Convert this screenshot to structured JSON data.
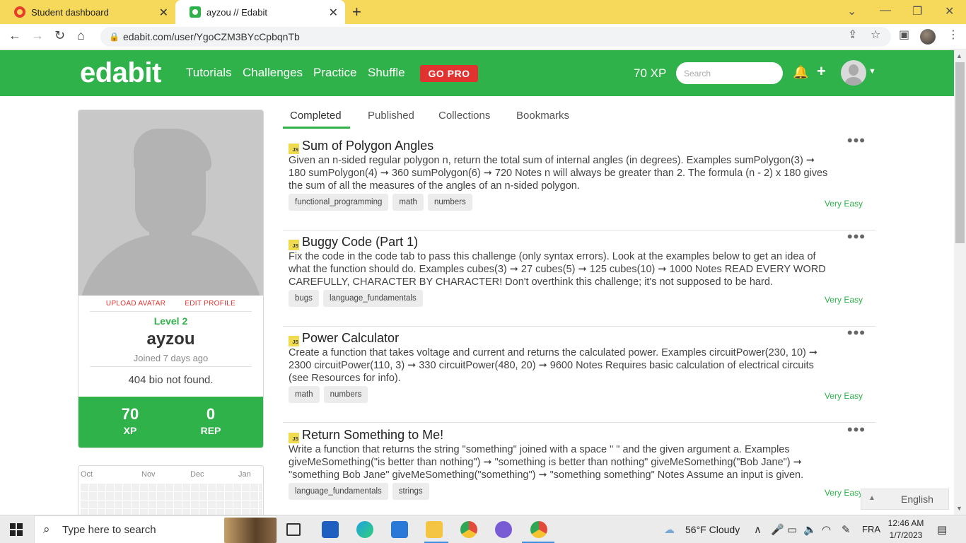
{
  "browser": {
    "tabs": [
      {
        "title": "Student dashboard"
      },
      {
        "title": "ayzou // Edabit"
      }
    ],
    "url": "edabit.com/user/YgoCZM3BYcCpbqnTb"
  },
  "header": {
    "logo": "edabit",
    "nav": [
      "Tutorials",
      "Challenges",
      "Practice",
      "Shuffle"
    ],
    "gopro": "GO PRO",
    "xp": "70 XP",
    "search_placeholder": "Search"
  },
  "profile": {
    "upload_avatar": "UPLOAD AVATAR",
    "edit_profile": "EDIT PROFILE",
    "level": "Level 2",
    "username": "ayzou",
    "joined": "Joined 7 days ago",
    "bio": "404 bio not found.",
    "xp_value": "70",
    "xp_label": "XP",
    "rep_value": "0",
    "rep_label": "REP",
    "months": [
      "Oct",
      "Nov",
      "Dec",
      "Jan"
    ]
  },
  "profile_tabs": [
    "Completed",
    "Published",
    "Collections",
    "Bookmarks"
  ],
  "challenges": [
    {
      "badge": "JS",
      "title": "Sum of Polygon Angles",
      "desc": "Given an n-sided regular polygon n, return the total sum of internal angles (in degrees). Examples sumPolygon(3) ➞ 180 sumPolygon(4) ➞ 360 sumPolygon(6) ➞ 720 Notes n will always be greater than 2. The formula (n - 2) x 180 gives the sum of all the measures of the angles of an n-sided polygon.",
      "tags": [
        "functional_programming",
        "math",
        "numbers"
      ],
      "difficulty": "Very Easy"
    },
    {
      "badge": "JS",
      "title": "Buggy Code (Part 1)",
      "desc": "Fix the code in the code tab to pass this challenge (only syntax errors). Look at the examples below to get an idea of what the function should do. Examples cubes(3) ➞ 27 cubes(5) ➞ 125 cubes(10) ➞ 1000 Notes READ EVERY WORD CAREFULLY, CHARACTER BY CHARACTER! Don't overthink this challenge; it's not supposed to be hard.",
      "tags": [
        "bugs",
        "language_fundamentals"
      ],
      "difficulty": "Very Easy"
    },
    {
      "badge": "JS",
      "title": "Power Calculator",
      "desc": "Create a function that takes voltage and current and returns the calculated power. Examples circuitPower(230, 10) ➞ 2300 circuitPower(110, 3) ➞ 330 circuitPower(480, 20) ➞ 9600 Notes Requires basic calculation of electrical circuits (see Resources for info).",
      "tags": [
        "math",
        "numbers"
      ],
      "difficulty": "Very Easy"
    },
    {
      "badge": "JS",
      "title": "Return Something to Me!",
      "desc": "Write a function that returns the string \"something\" joined with a space \" \" and the given argument a. Examples giveMeSomething(\"is better than nothing\") ➞ \"something is better than nothing\" giveMeSomething(\"Bob Jane\") ➞ \"something Bob Jane\" giveMeSomething(\"something\") ➞ \"something something\" Notes Assume an input is given.",
      "tags": [
        "language_fundamentals",
        "strings"
      ],
      "difficulty": "Very Easy"
    }
  ],
  "language": "English",
  "taskbar": {
    "search_text": "Type here to search",
    "weather": "56°F  Cloudy",
    "lang": "FRA",
    "time": "12:46 AM",
    "date": "1/7/2023"
  }
}
